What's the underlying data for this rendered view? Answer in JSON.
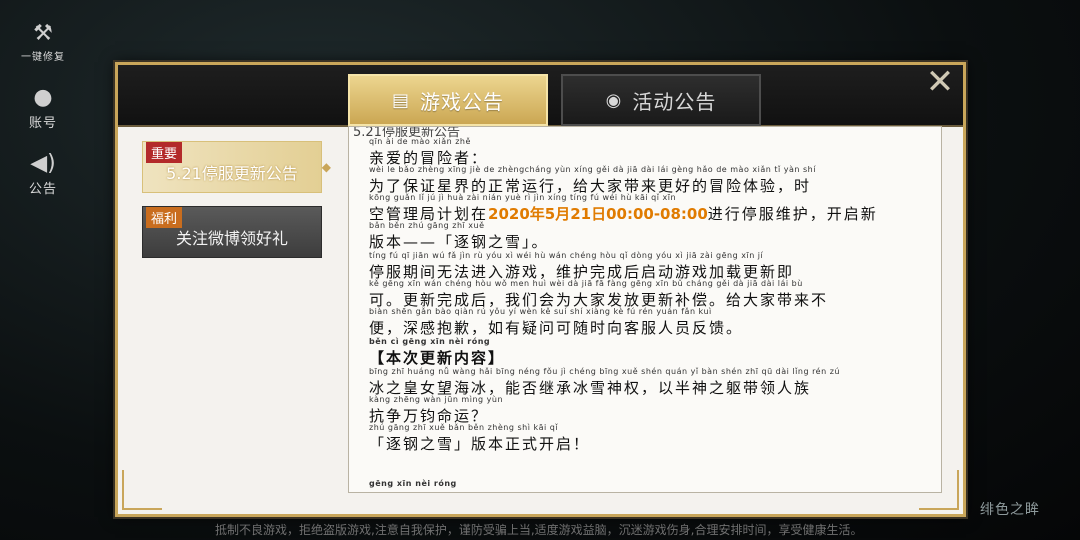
{
  "side_menu": [
    {
      "icon": "wrench-icon",
      "label": "一键修复"
    },
    {
      "icon": "person-icon",
      "label": "账号"
    },
    {
      "icon": "speaker-icon",
      "label": "公告"
    }
  ],
  "tabs": [
    {
      "label": "游戏公告",
      "icon": "notice-board-icon",
      "active": true
    },
    {
      "label": "活动公告",
      "icon": "activity-icon",
      "active": false
    }
  ],
  "close_label": "✕",
  "notices": [
    {
      "tag": "重要",
      "title": "5.21停服更新公告",
      "selected": true
    },
    {
      "tag": "福利",
      "title": "关注微博领好礼",
      "selected": false
    }
  ],
  "content": {
    "header": "5.21停服更新公告",
    "lines": [
      {
        "py": "qīn ài de mào xiǎn zhě",
        "tx": "亲爱的冒险者："
      },
      {
        "py": "wèi le bǎo zhèng xīng jiè de zhèngcháng yùn xíng gěi dà jiā dài lái gèng hǎo de mào xiǎn tǐ yàn shí",
        "tx": "为了保证星界的正常运行，给大家带来更好的冒险体验，时"
      },
      {
        "py": "kōng guǎn lǐ jú jì huà zài nián yuè rì jìn xíng tíng fú wéi hù kāi qǐ xīn",
        "tx_pre": "空管理局计划在",
        "tx_hl": "2020年5月21日00:00-08:00",
        "tx_post": "进行停服维护，开启新"
      },
      {
        "py": "bǎn běn zhú gāng zhī xuě",
        "tx": "版本——「逐钢之雪」。"
      },
      {
        "py": "tíng fú qī jiān wú fǎ jìn rù yóu xì wéi hù wán chéng hòu qǐ dòng yóu xì jiā zài gēng xīn jí",
        "tx": "停服期间无法进入游戏，维护完成后启动游戏加载更新即"
      },
      {
        "py": "kě gēng xīn wán chéng hòu wǒ men huì wèi dà jiā fā fàng gēng xīn bǔ cháng gěi dà jiā dài lái bù",
        "tx": "可。更新完成后，我们会为大家发放更新补偿。给大家带来不"
      },
      {
        "py": "biàn shēn gǎn bào qiàn rú yǒu yí wèn kě suí shí xiàng kè fú rén yuán fǎn kuì",
        "tx": "便，深感抱歉，如有疑问可随时向客服人员反馈。"
      },
      {
        "py": "běn cì gēng xīn nèi róng",
        "tx": "【本次更新内容】",
        "bold": true
      },
      {
        "py": "bīng zhī huáng nǚ wàng hǎi bīng néng fǒu jì chéng bīng xuě shén quán yǐ bàn shén zhī qū dài lǐng rén zú",
        "tx": "冰之皇女望海冰，能否继承冰雪神权，以半神之躯带领人族"
      },
      {
        "py": "kàng zhēng wàn jūn mìng yùn",
        "tx": "抗争万钧命运？"
      },
      {
        "py": "zhú gāng zhī xuě bǎn běn zhèng shì kāi qǐ",
        "tx": "「逐钢之雪」版本正式开启！"
      },
      {
        "py": "gēng xīn nèi róng",
        "tx": ""
      }
    ]
  },
  "bottom_notice": "抵制不良游戏，拒绝盗版游戏,注意自我保护，谨防受骗上当,适度游戏益脑，沉迷游戏伤身,合理安排时间，享受健康生活。",
  "brand": "绯色之眸",
  "colors": {
    "accent_gold": "#c9a65a",
    "highlight_orange": "#e07b00",
    "tag_red": "#b32a2a",
    "tag_orange": "#c96d1e"
  }
}
